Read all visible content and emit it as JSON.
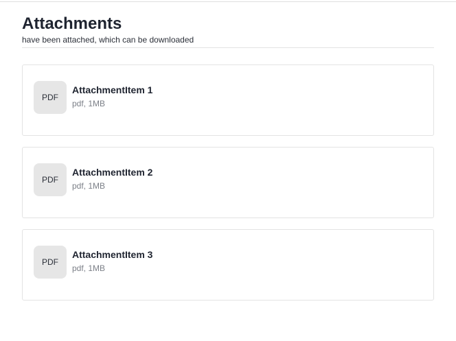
{
  "header": {
    "title": "Attachments",
    "subtitle": "have been attached, which can be downloaded"
  },
  "attachments": [
    {
      "badge": "PDF",
      "name": "AttachmentItem 1",
      "meta": "pdf, 1MB"
    },
    {
      "badge": "PDF",
      "name": "AttachmentItem 2",
      "meta": "pdf, 1MB"
    },
    {
      "badge": "PDF",
      "name": "AttachmentItem 3",
      "meta": "pdf, 1MB"
    }
  ],
  "colors": {
    "title": "#1f2430",
    "meta": "#7b7f87",
    "thumb_bg": "#e6e6e6",
    "border": "#e3e3e3"
  }
}
